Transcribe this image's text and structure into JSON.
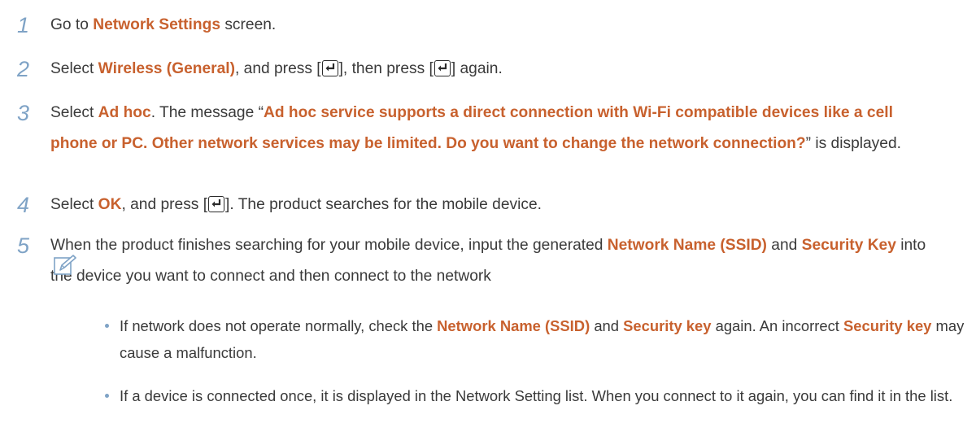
{
  "steps": [
    {
      "num": "1",
      "segments": [
        {
          "t": "Go to ",
          "s": "n"
        },
        {
          "t": "Network Settings",
          "s": "h"
        },
        {
          "t": " screen.",
          "s": "n"
        }
      ]
    },
    {
      "num": "2",
      "segments": [
        {
          "t": "Select ",
          "s": "n"
        },
        {
          "t": "Wireless (General)",
          "s": "h"
        },
        {
          "t": ", and press [",
          "s": "n"
        },
        {
          "t": "",
          "s": "key"
        },
        {
          "t": "], then press [",
          "s": "n"
        },
        {
          "t": "",
          "s": "key"
        },
        {
          "t": "] again.",
          "s": "n"
        }
      ]
    },
    {
      "num": "3",
      "segments": [
        {
          "t": "Select ",
          "s": "n"
        },
        {
          "t": "Ad hoc",
          "s": "h"
        },
        {
          "t": ". The message “",
          "s": "n"
        },
        {
          "t": "Ad hoc service supports a direct connection with Wi-Fi compatible devices like a cell phone or PC. Other network services may be limited. Do you want to change the network connection?",
          "s": "h"
        },
        {
          "t": "” is displayed.",
          "s": "n"
        }
      ]
    },
    {
      "num": "4",
      "segments": [
        {
          "t": "Select ",
          "s": "n"
        },
        {
          "t": "OK",
          "s": "h"
        },
        {
          "t": ", and press [",
          "s": "n"
        },
        {
          "t": "",
          "s": "key"
        },
        {
          "t": "]. The product searches for the mobile device.",
          "s": "n"
        }
      ]
    },
    {
      "num": "5",
      "segments": [
        {
          "t": "When the product finishes searching for your mobile device, input the generated ",
          "s": "n"
        },
        {
          "t": "Network Name (SSID)",
          "s": "h"
        },
        {
          "t": " and ",
          "s": "n"
        },
        {
          "t": "Security Key",
          "s": "h"
        },
        {
          "t": " into the device you want to connect and then connect to the network",
          "s": "n"
        }
      ]
    }
  ],
  "note": {
    "icon": "note-pencil-icon",
    "bullets": [
      {
        "segments": [
          {
            "t": "If network does not operate normally, check the ",
            "s": "n"
          },
          {
            "t": "Network Name (SSID)",
            "s": "h"
          },
          {
            "t": " and ",
            "s": "n"
          },
          {
            "t": "Security key",
            "s": "h"
          },
          {
            "t": " again. An incorrect ",
            "s": "n"
          },
          {
            "t": "Security key",
            "s": "h"
          },
          {
            "t": " may cause a malfunction.",
            "s": "n"
          }
        ]
      },
      {
        "segments": [
          {
            "t": "If a device is connected once, it is displayed in the Network Setting list. When you connect to it again, you can find it in the list.",
            "s": "n"
          }
        ]
      }
    ]
  },
  "colors": {
    "highlight": "#c8612e",
    "step_number": "#7fa3c6",
    "body_text": "#3a3a3a"
  },
  "icons": {
    "enter_key": "enter-key-icon"
  }
}
